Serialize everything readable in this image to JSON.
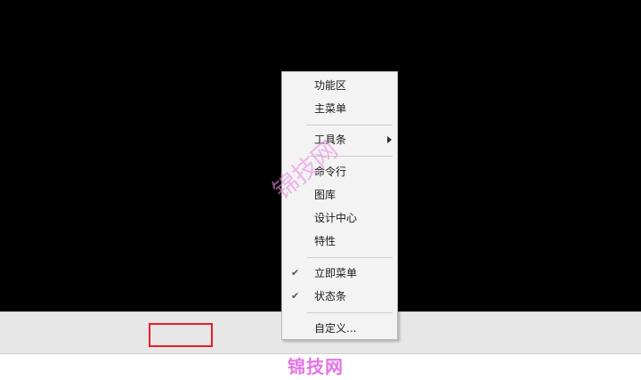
{
  "context_menu": {
    "items": [
      {
        "label": "功能区"
      },
      {
        "label": "主菜单"
      },
      {
        "label": "工具条"
      },
      {
        "label": "命令行"
      },
      {
        "label": "图库"
      },
      {
        "label": "设计中心"
      },
      {
        "label": "特性"
      },
      {
        "label": "立即菜单"
      },
      {
        "label": "状态条"
      },
      {
        "label": "自定义..."
      }
    ],
    "checked": [
      "立即菜单",
      "状态条"
    ],
    "check_mark": "✔",
    "submenu_item": "工具条"
  },
  "watermark": {
    "text": "锦技网"
  },
  "footer": {
    "brand": "锦技网"
  },
  "colors": {
    "canvas": "#000000",
    "status_bar": "#e7e7e7",
    "highlight": "#ee1c24",
    "brand": "#e673e6"
  }
}
